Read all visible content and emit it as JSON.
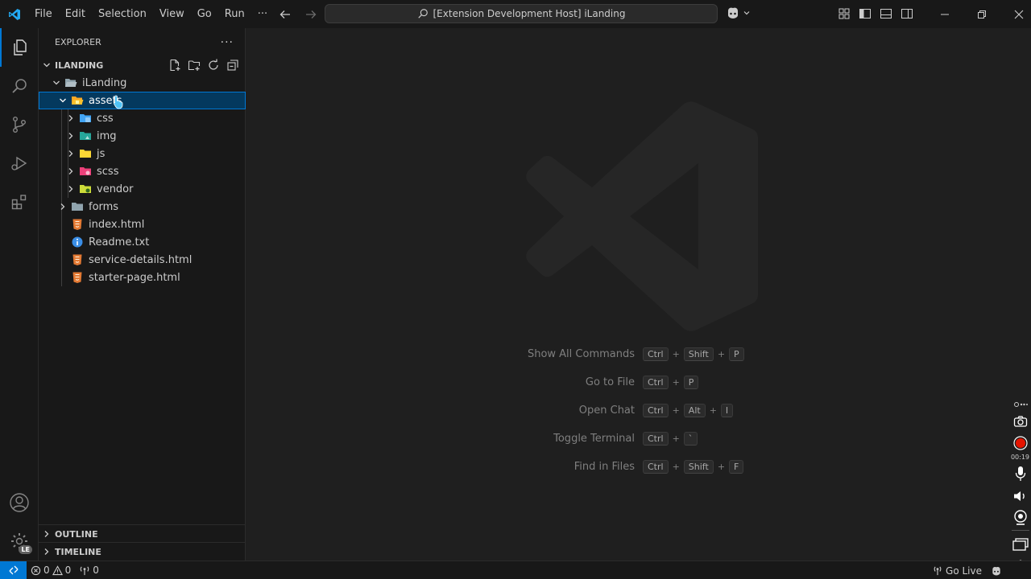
{
  "titlebar": {
    "menu": [
      "File",
      "Edit",
      "Selection",
      "View",
      "Go",
      "Run",
      "···"
    ],
    "command_center": "[Extension Development Host] iLanding"
  },
  "sidebar": {
    "title": "EXPLORER",
    "more": "···",
    "workspace": "ILANDING",
    "tree": [
      {
        "label": "iLanding",
        "depth": 0,
        "type": "folder",
        "expanded": true
      },
      {
        "label": "assets",
        "depth": 1,
        "type": "folder",
        "expanded": true,
        "selected": true
      },
      {
        "label": "css",
        "depth": 2,
        "type": "folder-css"
      },
      {
        "label": "img",
        "depth": 2,
        "type": "folder-img"
      },
      {
        "label": "js",
        "depth": 2,
        "type": "folder-js"
      },
      {
        "label": "scss",
        "depth": 2,
        "type": "folder-scss"
      },
      {
        "label": "vendor",
        "depth": 2,
        "type": "folder-vendor"
      },
      {
        "label": "forms",
        "depth": 1,
        "type": "folder"
      },
      {
        "label": "index.html",
        "depth": 1,
        "type": "html"
      },
      {
        "label": "Readme.txt",
        "depth": 1,
        "type": "info"
      },
      {
        "label": "service-details.html",
        "depth": 1,
        "type": "html"
      },
      {
        "label": "starter-page.html",
        "depth": 1,
        "type": "html"
      }
    ],
    "outline": "OUTLINE",
    "timeline": "TIMELINE"
  },
  "activity": {
    "accounts_badge": "LE"
  },
  "editor": {
    "shortcuts": [
      {
        "label": "Show All Commands",
        "keys": [
          "Ctrl",
          "Shift",
          "P"
        ]
      },
      {
        "label": "Go to File",
        "keys": [
          "Ctrl",
          "P"
        ]
      },
      {
        "label": "Open Chat",
        "keys": [
          "Ctrl",
          "Alt",
          "I"
        ]
      },
      {
        "label": "Toggle Terminal",
        "keys": [
          "Ctrl",
          "`"
        ]
      },
      {
        "label": "Find in Files",
        "keys": [
          "Ctrl",
          "Shift",
          "F"
        ]
      }
    ]
  },
  "recorder": {
    "time": "00:19"
  },
  "statusbar": {
    "errors": "0",
    "warnings": "0",
    "ports": "0",
    "go_live": "Go Live"
  },
  "colors": {
    "accent": "#0078d4",
    "selection": "#04395e",
    "html_icon": "#e37933",
    "info_icon": "#3a8ee6",
    "record": "#e51400"
  }
}
